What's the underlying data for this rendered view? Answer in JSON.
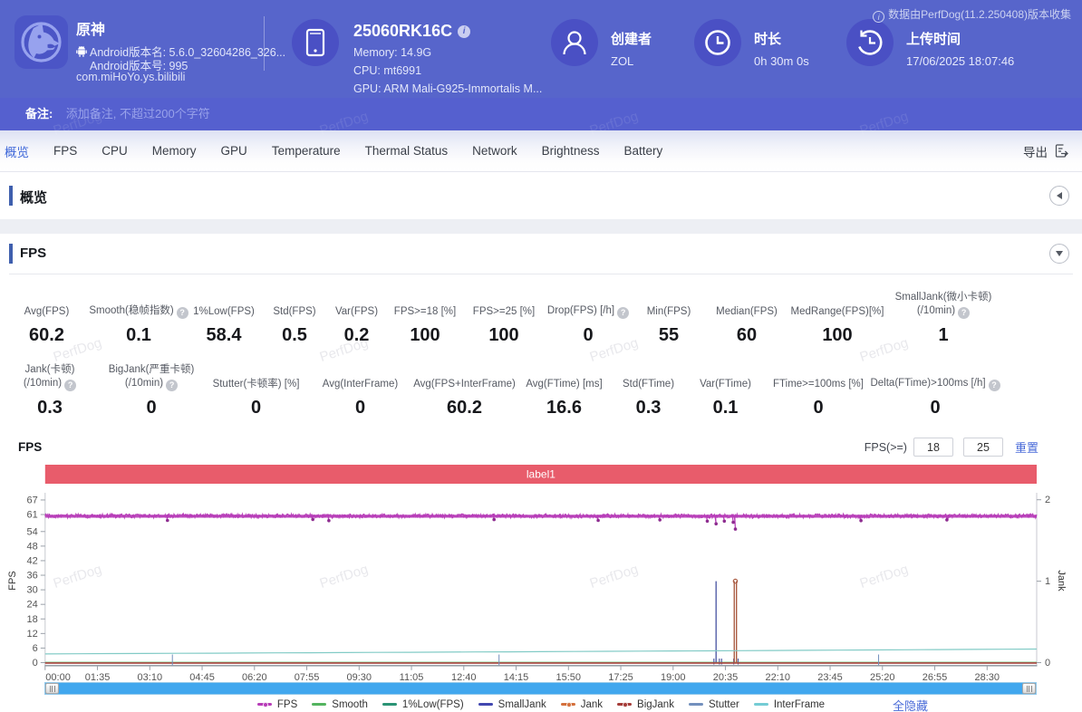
{
  "header": {
    "app": {
      "name": "原神",
      "version_line1": "Android版本名: 5.6.0_32604286_326...",
      "version_line2": "Android版本号: 995",
      "package": "com.miHoYo.ys.bilibili"
    },
    "device": {
      "model": "25060RK16C",
      "memory": "Memory: 14.9G",
      "cpu": "CPU: mt6991",
      "gpu": "GPU: ARM Mali-G925-Immortalis M..."
    },
    "meta": [
      {
        "icon": "user-icon",
        "label": "创建者",
        "value": "ZOL"
      },
      {
        "icon": "clock-icon",
        "label": "时长",
        "value": "0h 30m 0s"
      },
      {
        "icon": "history-icon",
        "label": "上传时间",
        "value": "17/06/2025 18:07:46"
      }
    ],
    "collect_info": "数据由PerfDog(11.2.250408)版本收集"
  },
  "note_bar": {
    "label": "备注:",
    "placeholder": "添加备注, 不超过200个字符"
  },
  "tabs": {
    "items": [
      "概览",
      "FPS",
      "CPU",
      "Memory",
      "GPU",
      "Temperature",
      "Thermal Status",
      "Network",
      "Brightness",
      "Battery"
    ],
    "active_index": 0,
    "export_label": "导出"
  },
  "sections": {
    "overview_title": "概览",
    "fps_title": "FPS"
  },
  "stats": {
    "row1": [
      {
        "lines": [
          "Avg(FPS)"
        ],
        "help": false,
        "value": "60.2"
      },
      {
        "lines": [
          "Smooth(稳帧指数)"
        ],
        "help": true,
        "value": "0.1"
      },
      {
        "lines": [
          "1%Low(FPS)"
        ],
        "help": false,
        "value": "58.4"
      },
      {
        "lines": [
          "Std(FPS)"
        ],
        "help": false,
        "value": "0.5"
      },
      {
        "lines": [
          "Var(FPS)"
        ],
        "help": false,
        "value": "0.2"
      },
      {
        "lines": [
          "FPS>=18 [%]"
        ],
        "help": false,
        "value": "100"
      },
      {
        "lines": [
          "FPS>=25 [%]"
        ],
        "help": false,
        "value": "100"
      },
      {
        "lines": [
          "Drop(FPS) [/h]"
        ],
        "help": true,
        "value": "0"
      },
      {
        "lines": [
          "Min(FPS)"
        ],
        "help": false,
        "value": "55"
      },
      {
        "lines": [
          "Median(FPS)"
        ],
        "help": false,
        "value": "60"
      },
      {
        "lines": [
          "MedRange(FPS)[%]"
        ],
        "help": false,
        "value": "100"
      },
      {
        "lines": [
          "SmallJank(微小卡顿)",
          "(/10min)"
        ],
        "help": true,
        "value": "1"
      }
    ],
    "row2": [
      {
        "lines": [
          "Jank(卡顿)",
          "(/10min)"
        ],
        "help": true,
        "value": "0.3"
      },
      {
        "lines": [
          "BigJank(严重卡顿)",
          "(/10min)"
        ],
        "help": true,
        "value": "0"
      },
      {
        "lines": [
          "Stutter(卡顿率) [%]"
        ],
        "help": false,
        "value": "0"
      },
      {
        "lines": [
          "Avg(InterFrame)"
        ],
        "help": false,
        "value": "0"
      },
      {
        "lines": [
          "Avg(FPS+InterFrame)"
        ],
        "help": false,
        "value": "60.2"
      },
      {
        "lines": [
          "Avg(FTime) [ms]"
        ],
        "help": false,
        "value": "16.6"
      },
      {
        "lines": [
          "Std(FTime)"
        ],
        "help": false,
        "value": "0.3"
      },
      {
        "lines": [
          "Var(FTime)"
        ],
        "help": false,
        "value": "0.1"
      },
      {
        "lines": [
          "FTime>=100ms [%]"
        ],
        "help": false,
        "value": "0"
      },
      {
        "lines": [
          "Delta(FTime)>100ms [/h]"
        ],
        "help": true,
        "value": "0"
      }
    ]
  },
  "fps_panel": {
    "panel_label": "FPS",
    "threshold_label": "FPS(>=)",
    "threshold1": "18",
    "threshold2": "25",
    "reset_label": "重置",
    "hide_all_label": "全隐藏"
  },
  "chart_data": {
    "type": "line",
    "title_banner": "label1",
    "banner_color": "#e85c6b",
    "xlabel_ticks": [
      "00:00",
      "01:35",
      "03:10",
      "04:45",
      "06:20",
      "07:55",
      "09:30",
      "11:05",
      "12:40",
      "14:15",
      "15:50",
      "17:25",
      "19:00",
      "20:35",
      "22:10",
      "23:45",
      "25:20",
      "26:55",
      "28:30"
    ],
    "x_tick_interval_sec": 95,
    "x_range_sec": [
      0,
      1800
    ],
    "left_axis": {
      "label": "FPS",
      "ticks": [
        67,
        61,
        54,
        48,
        42,
        36,
        30,
        24,
        18,
        12,
        6,
        0
      ],
      "range": [
        0,
        67
      ]
    },
    "right_axis": {
      "label": "Jank",
      "ticks": [
        2,
        1,
        0
      ],
      "range": [
        0,
        2
      ]
    },
    "series": [
      {
        "name": "FPS",
        "color": "#b73cb8",
        "dot_color": "#8e2d90",
        "axis": "left",
        "kind": "noisy-band",
        "base": 60.3,
        "noise": 0.85,
        "drops": [
          {
            "t": 222,
            "v": 58.6
          },
          {
            "t": 486,
            "v": 59.0
          },
          {
            "t": 515,
            "v": 58.5
          },
          {
            "t": 815,
            "v": 58.9
          },
          {
            "t": 1004,
            "v": 58.6
          },
          {
            "t": 1116,
            "v": 58.8
          },
          {
            "t": 1202,
            "v": 58.3
          },
          {
            "t": 1218,
            "v": 57.2
          },
          {
            "t": 1233,
            "v": 58.3
          },
          {
            "t": 1249,
            "v": 57.8
          },
          {
            "t": 1253,
            "v": 55.0
          },
          {
            "t": 1481,
            "v": 58.5
          },
          {
            "t": 1637,
            "v": 58.8
          }
        ]
      },
      {
        "name": "Smooth",
        "color": "#53b45f",
        "axis": "left",
        "kind": "flat",
        "value": 0.15
      },
      {
        "name": "1%Low(FPS)",
        "color": "#2b9475",
        "axis": "left",
        "kind": "hidden",
        "value": 58.4
      },
      {
        "name": "SmallJank",
        "color": "#5560a8",
        "axis": "right",
        "kind": "spikes",
        "baseline": 0,
        "spikes": [
          {
            "t": 1218,
            "v": 1
          }
        ],
        "base_ticks": [
          1214,
          1224,
          1228,
          1250,
          1258
        ]
      },
      {
        "name": "Jank",
        "color": "#ab5d44",
        "axis": "right",
        "kind": "spikes",
        "baseline": 0,
        "spikes": [
          {
            "t": 1251,
            "v": 1
          },
          {
            "t": 1255,
            "v": 1
          }
        ],
        "top_dot": true
      },
      {
        "name": "BigJank",
        "color": "#a53c38",
        "axis": "right",
        "kind": "flat-right",
        "value": 0
      },
      {
        "name": "Stutter",
        "color": "#7390bd",
        "axis": "right",
        "kind": "artifact-ticks",
        "ticks": [
          231,
          824,
          1513
        ]
      },
      {
        "name": "InterFrame",
        "color": "#82cbc6",
        "axis": "left",
        "kind": "trend",
        "start": 3.6,
        "end": 5.6
      }
    ],
    "legend": [
      {
        "label": "FPS",
        "color": "#b73cb8",
        "marker": "dot"
      },
      {
        "label": "Smooth",
        "color": "#53b45f",
        "marker": "line"
      },
      {
        "label": "1%Low(FPS)",
        "color": "#2b9475",
        "marker": "line"
      },
      {
        "label": "SmallJank",
        "color": "#4147b0",
        "marker": "line"
      },
      {
        "label": "Jank",
        "color": "#d4703c",
        "marker": "dot"
      },
      {
        "label": "BigJank",
        "color": "#a53c38",
        "marker": "dot"
      },
      {
        "label": "Stutter",
        "color": "#7390bd",
        "marker": "line"
      },
      {
        "label": "InterFrame",
        "color": "#74ccd4",
        "marker": "line"
      }
    ],
    "grid": false,
    "legend_position": "bottom"
  },
  "watermark": "PerfDog"
}
